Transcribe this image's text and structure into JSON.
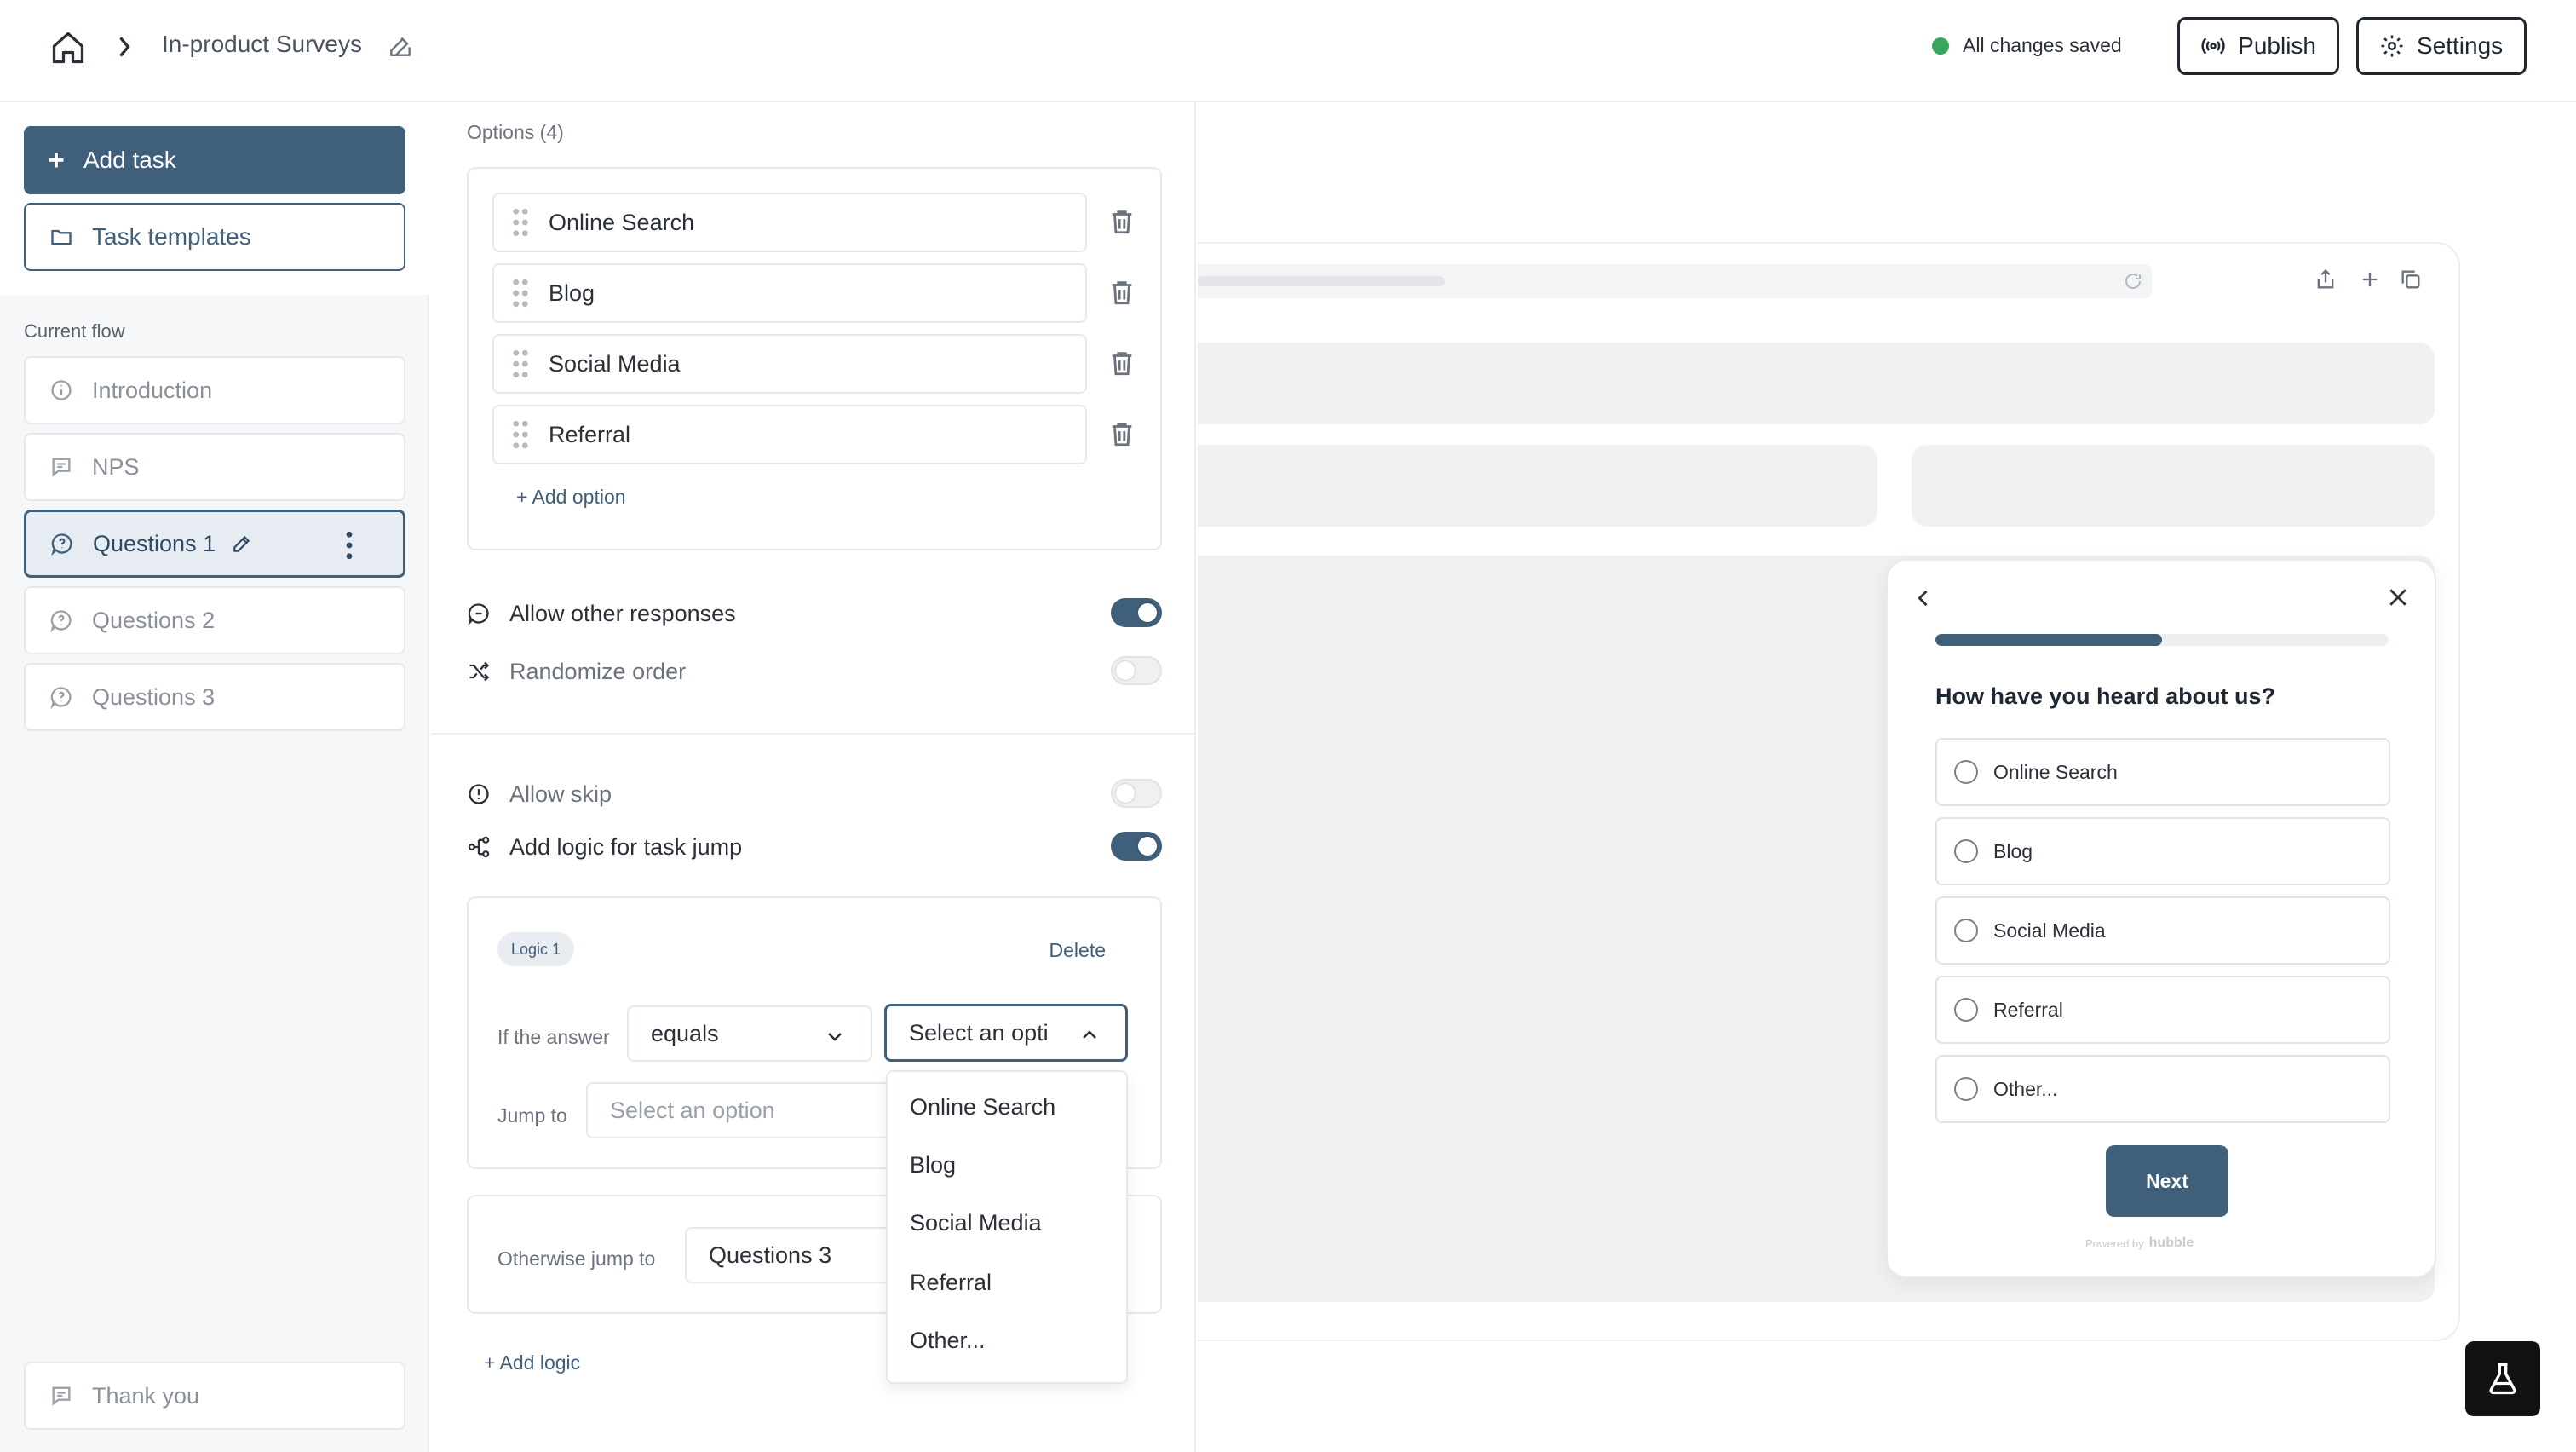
{
  "header": {
    "breadcrumb_title": "In-product Surveys",
    "save_status": "All changes saved",
    "publish_label": "Publish",
    "settings_label": "Settings"
  },
  "sidebar": {
    "add_task_label": "Add task",
    "task_templates_label": "Task templates",
    "current_flow_label": "Current flow",
    "items": [
      {
        "label": "Introduction",
        "icon": "info-icon"
      },
      {
        "label": "NPS",
        "icon": "message-icon"
      },
      {
        "label": "Questions 1",
        "icon": "question-bubble-icon",
        "active": true
      },
      {
        "label": "Questions 2",
        "icon": "question-bubble-icon"
      },
      {
        "label": "Questions 3",
        "icon": "question-bubble-icon"
      }
    ],
    "thank_you_label": "Thank you"
  },
  "editor": {
    "options_label": "Options (4)",
    "options": [
      "Online Search",
      "Blog",
      "Social Media",
      "Referral"
    ],
    "add_option_label": "+ Add option",
    "allow_other_label": "Allow other responses",
    "allow_other_on": true,
    "randomize_label": "Randomize order",
    "randomize_on": false,
    "allow_skip_label": "Allow skip",
    "allow_skip_on": false,
    "task_jump_label": "Add logic for task jump",
    "task_jump_on": true,
    "logic": {
      "badge": "Logic 1",
      "delete_label": "Delete",
      "if_label": "If the answer",
      "operator_value": "equals",
      "answer_value": "Select an opti",
      "jump_label": "Jump to",
      "jump_placeholder": "Select an option",
      "dropdown_options": [
        "Online Search",
        "Blog",
        "Social Media",
        "Referral",
        "Other..."
      ]
    },
    "otherwise_label": "Otherwise jump to",
    "otherwise_value": "Questions 3",
    "add_logic_label": "+ Add logic"
  },
  "survey": {
    "question": "How have you heard about us?",
    "progress": 0.5,
    "options": [
      "Online Search",
      "Blog",
      "Social Media",
      "Referral",
      "Other..."
    ],
    "next_label": "Next",
    "powered_by": "Powered by",
    "brand": "hubble"
  },
  "colors": {
    "accent": "#3f5f7b",
    "saved_dot": "#3aa55f"
  }
}
